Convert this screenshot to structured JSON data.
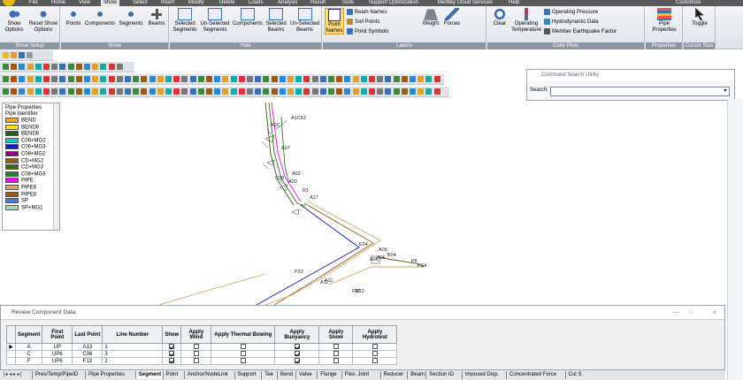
{
  "menu": {
    "items": [
      "File",
      "Home",
      "View",
      "Show",
      "Select",
      "Insert",
      "Modify",
      "Delete",
      "Loads",
      "Analysis",
      "Result",
      "Tools",
      "Support Optimization",
      "Bentley Cloud Services",
      "Help"
    ],
    "right": "Customize"
  },
  "ribbon": {
    "show_setup": {
      "label": "Show Setup",
      "show_options": "Show Options",
      "reset_show_options": "Reset Show Options"
    },
    "show": {
      "label": "Show",
      "points": "Points",
      "components": "Components",
      "segments": "Segments",
      "beams": "Beams"
    },
    "hide": {
      "label": "Hide",
      "selected_segments": "Selected Segments",
      "unselected_segments": "Un-Selected Segments",
      "components": "Components",
      "selected_beams": "Selected Beams",
      "unselected_beams": "Un-Selected Beams"
    },
    "labels": {
      "label": "Labels",
      "point_names": "Point Names",
      "beam_names": "Beam Names",
      "soil_points": "Soil Points",
      "point_symbols": "Point Symbols",
      "weight": "Weight",
      "forces": "Forces"
    },
    "color_plots": {
      "label": "Color Plots",
      "clear": "Clear",
      "operating_temperature": "Operating Temperature",
      "operating_pressure": "Operating Pressure",
      "hydrodynamic_data": "Hydrodynamic Data",
      "member_earthquake_factor": "Member Earthquake Factor"
    },
    "properties": {
      "label": "Properties",
      "pipe_properties": "Pipe Properties"
    },
    "cursor_size": {
      "label": "Cursor Size",
      "toggle": "Toggle"
    }
  },
  "legend": {
    "title": "Pipe Properties",
    "subtitle": "Pipe Identifier",
    "items": [
      {
        "label": "BEND",
        "color": "#f0a830"
      },
      {
        "label": "BEND6",
        "color": "#f8e000"
      },
      {
        "label": "BEND8",
        "color": "#2a5a1a"
      },
      {
        "label": "C06+MG2",
        "color": "#18c8c8"
      },
      {
        "label": "C06+MG3",
        "color": "#1818c0"
      },
      {
        "label": "C08+MG2",
        "color": "#900070"
      },
      {
        "label": "CD+MG2",
        "color": "#9a5a18"
      },
      {
        "label": "CD+MG3",
        "color": "#3a6a1a"
      },
      {
        "label": "C08+MG3",
        "color": "#288030"
      },
      {
        "label": "PIPE",
        "color": "#ff00ff"
      },
      {
        "label": "PIPE6",
        "color": "#c8a870"
      },
      {
        "label": "PIPE8",
        "color": "#9a5a18"
      },
      {
        "label": "SP",
        "color": "#4a7ad8"
      },
      {
        "label": "SP+MG1",
        "color": "#a8d8b8"
      }
    ]
  },
  "command": {
    "title": "Command Search Utility",
    "search_label": "Search:",
    "search_value": ""
  },
  "canvas_labels": [
    "A1C63",
    "A0C",
    "A07",
    "C08",
    "A02",
    "A03",
    "R1",
    "E04",
    "A05",
    "A06",
    "A0F",
    "A17",
    "B04",
    "P6",
    "PS4",
    "P22",
    "A11",
    "A11",
    "F02",
    "B12"
  ],
  "review": {
    "title": "Review Component Data",
    "columns": [
      "Segment",
      "First Point",
      "Last Point",
      "Line Number",
      "Show",
      "Apply Wind",
      "Apply Thermal Bowing",
      "Apply Buoyancy",
      "Apply Snow",
      "Apply Hydrotest"
    ],
    "rows": [
      {
        "segment": "A",
        "first": "UP",
        "last": "A13",
        "line": "1",
        "show": true,
        "wind": false,
        "thermal": false,
        "buoyancy": true,
        "snow": false,
        "hydro": false
      },
      {
        "segment": "C",
        "first": "UP6",
        "last": "C06",
        "line": "3",
        "show": true,
        "wind": false,
        "thermal": false,
        "buoyancy": true,
        "snow": false,
        "hydro": false
      },
      {
        "segment": "F",
        "first": "UP6",
        "last": "F13",
        "line": "2",
        "show": true,
        "wind": false,
        "thermal": false,
        "buoyancy": true,
        "snow": false,
        "hydro": false
      }
    ]
  },
  "tabs": [
    "Pres/Temp/PipeID",
    "Pipe Properties",
    "Segment",
    "Point",
    "Anchor/NodeLink",
    "Support",
    "Tee",
    "Bend",
    "Valve",
    "Flange",
    "Flex. Joint",
    "Reducer",
    "Beam",
    "Section ID",
    "Imposed Disp.",
    "Concentrated Force",
    "Cut S"
  ],
  "selected_tab": "Segment"
}
